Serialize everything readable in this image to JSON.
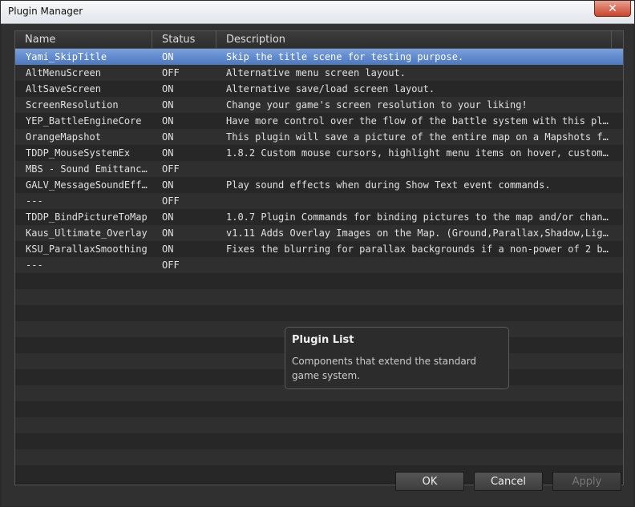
{
  "window": {
    "title": "Plugin Manager",
    "close_glyph": "✕"
  },
  "columns": {
    "name": "Name",
    "status": "Status",
    "description": "Description"
  },
  "plugins": [
    {
      "name": "Yami_SkipTitle",
      "status": "ON",
      "description": "Skip the title scene for testing purpose."
    },
    {
      "name": "AltMenuScreen",
      "status": "OFF",
      "description": "Alternative menu screen layout."
    },
    {
      "name": "AltSaveScreen",
      "status": "ON",
      "description": "Alternative save/load screen layout."
    },
    {
      "name": "ScreenResolution",
      "status": "ON",
      "description": "Change your game's screen resolution to your liking!"
    },
    {
      "name": "YEP_BattleEngineCore",
      "status": "ON",
      "description": "Have more control over the flow of the battle system with this plugi…"
    },
    {
      "name": "OrangeMapshot",
      "status": "ON",
      "description": "This plugin will save a picture of the entire map on a Mapshots fold…"
    },
    {
      "name": "TDDP_MouseSystemEx",
      "status": "ON",
      "description": "1.8.2 Custom mouse cursors, highlight menu items on hover, custom ev…"
    },
    {
      "name": "MBS - Sound Emittance…",
      "status": "OFF",
      "description": ""
    },
    {
      "name": "GALV_MessageSoundEffe…",
      "status": "ON",
      "description": "Play sound effects when during Show Text event commands."
    },
    {
      "name": "---",
      "status": "OFF",
      "description": ""
    },
    {
      "name": "TDDP_BindPictureToMap",
      "status": "ON",
      "description": "1.0.7 Plugin Commands for binding pictures to the map and/or changin…"
    },
    {
      "name": "Kaus_Ultimate_Overlay",
      "status": "ON",
      "description": "v1.11 Adds Overlay Images on the Map. (Ground,Parallax,Shadow,Light,…"
    },
    {
      "name": "KSU_ParallaxSmoothing",
      "status": "ON",
      "description": "Fixes the blurring for parallax backgrounds if a non-power of 2 back…"
    },
    {
      "name": "---",
      "status": "OFF",
      "description": ""
    }
  ],
  "selected_index": 0,
  "tooltip": {
    "title": "Plugin List",
    "body": "Components that extend the standard game system."
  },
  "buttons": {
    "ok": "OK",
    "cancel": "Cancel",
    "apply": "Apply"
  }
}
